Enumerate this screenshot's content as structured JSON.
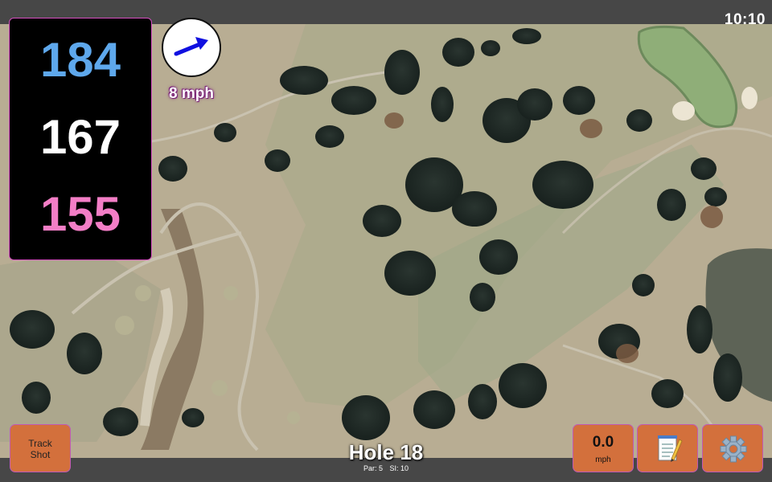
{
  "status_bar": {
    "time": "10:10"
  },
  "yardages": {
    "back": "184",
    "middle": "167",
    "front": "155"
  },
  "wind": {
    "speed_label": "8 mph",
    "icon": "wind-direction-arrow-icon"
  },
  "hole": {
    "title": "Hole 18",
    "par": "Par: 5",
    "stroke_index": "SI: 10"
  },
  "buttons": {
    "track_shot_line1": "Track",
    "track_shot_line2": "Shot",
    "speed_value": "0.0",
    "speed_unit": "mph",
    "notes_icon": "notepad-icon",
    "settings_icon": "gear-icon"
  },
  "colors": {
    "back_yardage": "#5ea8ec",
    "middle_yardage": "#ffffff",
    "front_yardage": "#f37ec6",
    "button": "#d3703c",
    "accent_border": "#c05ab6"
  }
}
